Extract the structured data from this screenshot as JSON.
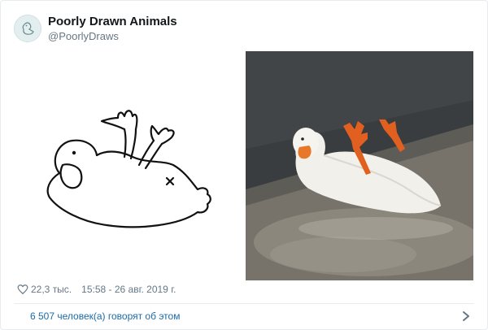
{
  "tweet": {
    "display_name": "Poorly Drawn Animals",
    "handle": "@PoorlyDraws",
    "likes": "22,3 тыс.",
    "timestamp": "15:58 - 26 авг. 2019 г.",
    "people_talking": "6 507 человек(а) говорят об этом"
  },
  "icons": {
    "avatar": "duck-doodle-avatar",
    "like": "heart-icon",
    "more": "chevron-right-icon"
  },
  "colors": {
    "text": "#14171a",
    "muted": "#657786",
    "link": "#1b6ba8",
    "border": "#e6ecf0"
  }
}
